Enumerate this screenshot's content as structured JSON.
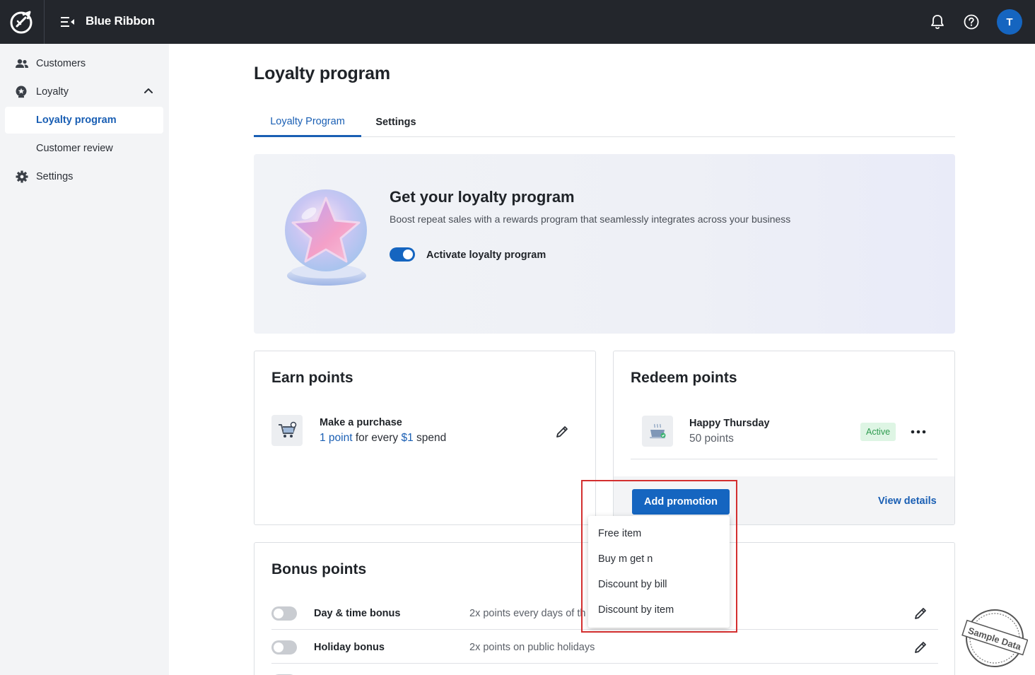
{
  "app": {
    "brand": "Blue Ribbon",
    "avatar_initial": "T"
  },
  "icons": {
    "logo": "app-logo-icon",
    "menu_toggle": "collapse-menu-icon",
    "notifications": "bell-icon",
    "help": "help-circle-icon"
  },
  "sidebar": {
    "items": [
      {
        "label": "Customers",
        "icon": "users-icon"
      },
      {
        "label": "Loyalty",
        "icon": "loyalty-badge-icon",
        "expanded": true
      },
      {
        "label": "Loyalty program",
        "active": true
      },
      {
        "label": "Customer review"
      },
      {
        "label": "Settings",
        "icon": "gear-icon"
      }
    ]
  },
  "page": {
    "title": "Loyalty program",
    "tabs": [
      {
        "label": "Loyalty Program",
        "active": true
      },
      {
        "label": "Settings",
        "active": false
      }
    ]
  },
  "hero": {
    "title": "Get your loyalty program",
    "subtitle": "Boost repeat sales with a rewards program that seamlessly integrates across your business",
    "toggle_label": "Activate loyalty program",
    "toggle_on": true
  },
  "earn": {
    "title": "Earn points",
    "item_name": "Make a purchase",
    "desc_part1": "1 point",
    "desc_part2": " for every ",
    "desc_part3": "$1",
    "desc_part4": " spend"
  },
  "redeem": {
    "title": "Redeem points",
    "item_name": "Happy Thursday",
    "item_points": "50 points",
    "status": "Active",
    "add_button": "Add promotion",
    "view_details": "View details"
  },
  "promotion_menu": {
    "options": [
      "Free item",
      "Buy m get n",
      "Discount by bill",
      "Discount by item"
    ]
  },
  "bonus": {
    "title": "Bonus points",
    "rows": [
      {
        "name": "Day & time bonus",
        "desc": "2x points every days of th",
        "enabled": false
      },
      {
        "name": "Holiday bonus",
        "desc": "2x points on public holidays",
        "enabled": false
      }
    ]
  },
  "watermark": {
    "text": "Sample Data"
  },
  "colors": {
    "accent": "#1565c0",
    "link": "#1a5fb4",
    "topbar": "#23262c",
    "sidebar": "#f3f4f6",
    "active_badge_bg": "#def5e4",
    "active_badge_text": "#2e9b4f",
    "highlight": "#d32f2f"
  }
}
